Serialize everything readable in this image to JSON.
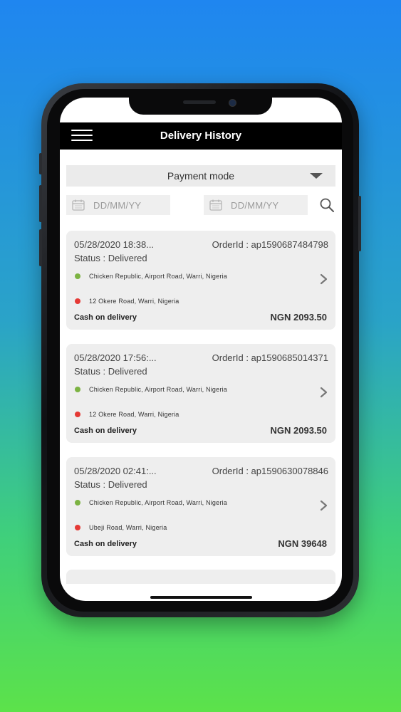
{
  "header": {
    "title": "Delivery History"
  },
  "filters": {
    "payment_mode": "Payment mode",
    "from_date_placeholder": "DD/MM/YY",
    "to_date_placeholder": "DD/MM/YY"
  },
  "orders": [
    {
      "date": "05/28/2020 18:38...",
      "order_id": "OrderId : ap1590687484798",
      "status": "Status : Delivered",
      "pickup": "Chicken Republic, Airport Road, Warri, Nigeria",
      "dropoff": "12 Okere Road, Warri, Nigeria",
      "payment": "Cash on delivery",
      "amount": "NGN 2093.50"
    },
    {
      "date": "05/28/2020 17:56:...",
      "order_id": "OrderId : ap1590685014371",
      "status": "Status : Delivered",
      "pickup": "Chicken Republic, Airport Road, Warri, Nigeria",
      "dropoff": "12 Okere Road, Warri, Nigeria",
      "payment": "Cash on delivery",
      "amount": "NGN 2093.50"
    },
    {
      "date": "05/28/2020 02:41:...",
      "order_id": "OrderId : ap1590630078846",
      "status": "Status : Delivered",
      "pickup": "Chicken Republic, Airport Road, Warri, Nigeria",
      "dropoff": "Ubeji Road, Warri, Nigeria",
      "payment": "Cash on delivery",
      "amount": "NGN 39648"
    }
  ],
  "icons": {
    "menu": "hamburger-menu-icon",
    "dropdown": "caret-down-icon",
    "calendar": "calendar-icon",
    "search": "search-icon",
    "chevron": "chevron-right-icon",
    "pickup_dot": "green-dot-icon",
    "dropoff_dot": "red-dot-icon"
  },
  "colors": {
    "appbar": "#000000",
    "pickup_dot": "#7cb342",
    "dropoff_dot": "#e53935",
    "card_bg": "#eeeeee"
  }
}
